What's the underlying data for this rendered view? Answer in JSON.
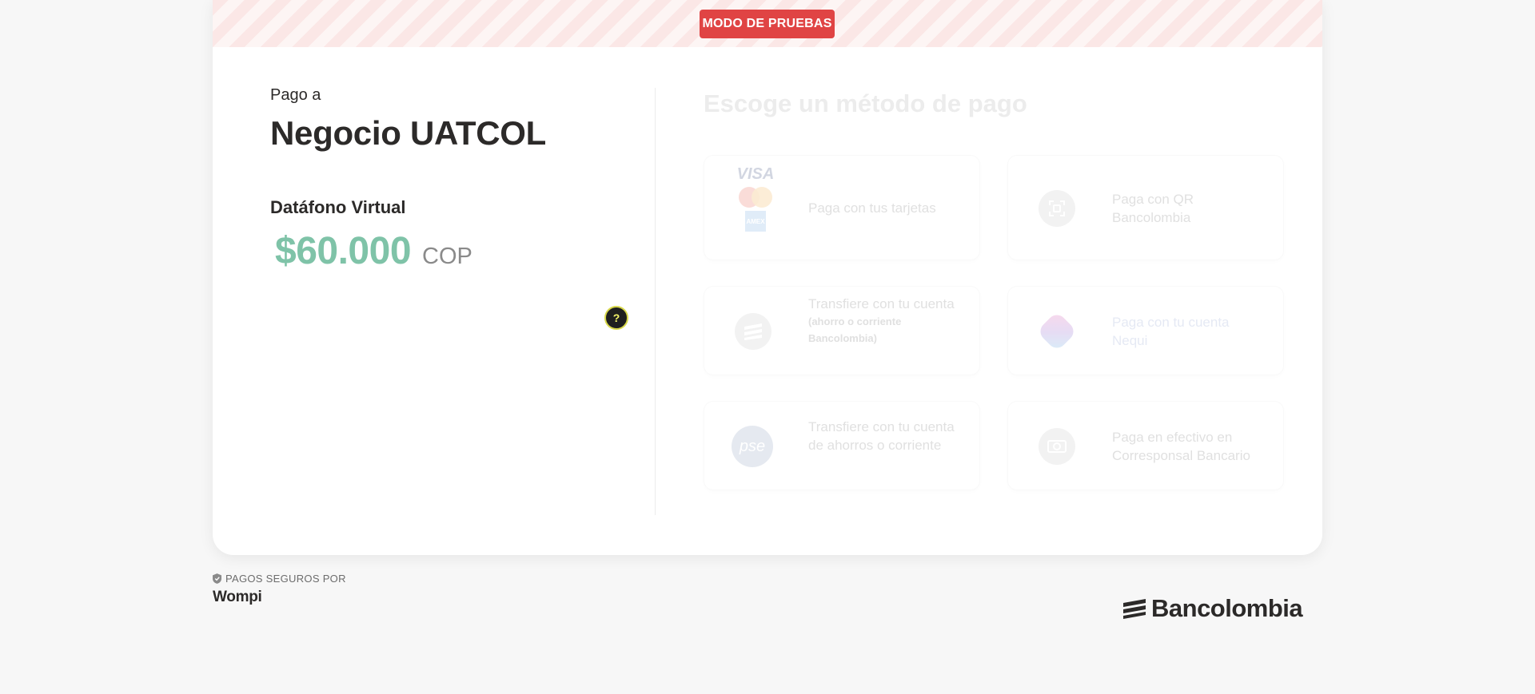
{
  "test_mode": {
    "label": "MODO DE PRUEBAS"
  },
  "summary": {
    "pay_to_label": "Pago a",
    "merchant_name": "Negocio UATCOL",
    "product_name": "Datáfono Virtual",
    "amount": "$60.000",
    "currency": "COP",
    "help_symbol": "?"
  },
  "payment_methods": {
    "title": "Escoge un método de pago",
    "items": [
      {
        "label": "Paga con tus tarjetas",
        "icon": "card-brands-icon",
        "brands": [
          "VISA",
          "AMEX"
        ]
      },
      {
        "label": "Paga con QR Bancolombia",
        "icon": "qr-scan-icon"
      },
      {
        "label": "Transfiere con tu cuenta",
        "sublabel": "(ahorro o corriente Bancolombia)",
        "icon": "bancolombia-icon"
      },
      {
        "label": "Paga con tu cuenta Nequi",
        "icon": "nequi-icon"
      },
      {
        "label": "Transfiere con tu cuenta de ahorros o corriente",
        "icon": "pse-icon",
        "icon_text": "pse"
      },
      {
        "label": "Paga en efectivo en Corresponsal Bancario",
        "icon": "cash-icon"
      }
    ]
  },
  "footer": {
    "secure_label": "PAGOS SEGUROS POR",
    "wompi_logo": "Wompi",
    "bancolombia_logo": "Bancolombia"
  },
  "colors": {
    "test_badge": "#e04444",
    "amount": "#7fc3a8",
    "background": "#f7f7f7"
  }
}
